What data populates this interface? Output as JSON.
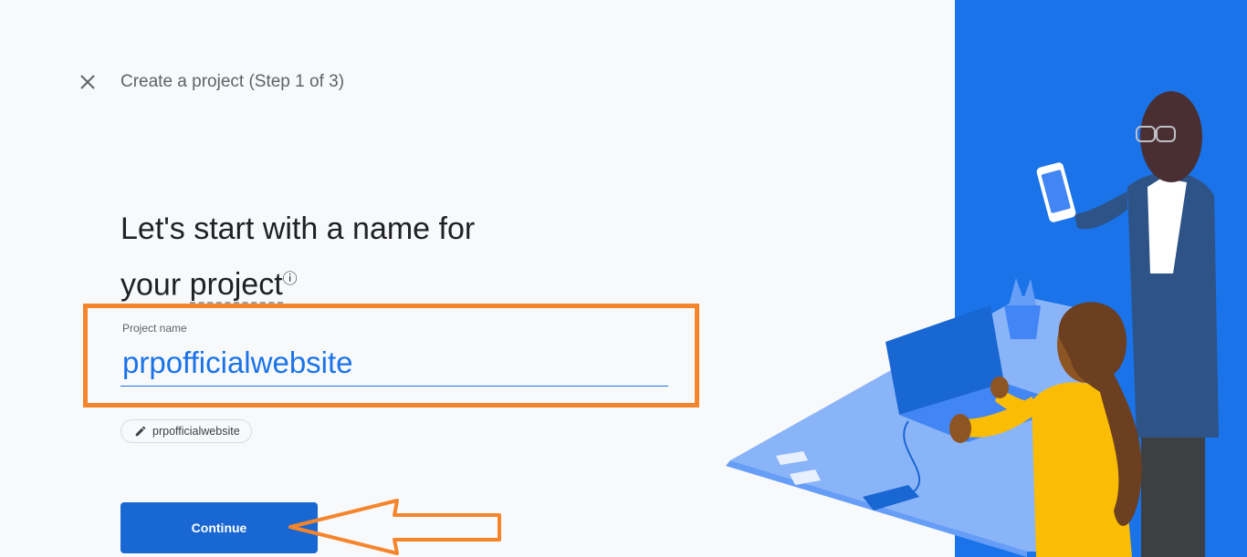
{
  "header": {
    "close_icon": "close-icon",
    "title": "Create a project (Step 1 of 3)"
  },
  "main": {
    "heading_line1": "Let's start with a name for",
    "heading_line2_prefix": "your ",
    "heading_term": "project",
    "help_icon": "help-circle-icon",
    "project_name": {
      "label": "Project name",
      "value": "prpofficialwebsite"
    },
    "project_id_chip": {
      "icon": "pencil-icon",
      "text": "prpofficialwebsite"
    },
    "continue_label": "Continue"
  },
  "colors": {
    "accent": "#1a73e8",
    "button": "#1967d2",
    "annotation": "#f5852c",
    "illustration_bg": "#1a73e8"
  }
}
